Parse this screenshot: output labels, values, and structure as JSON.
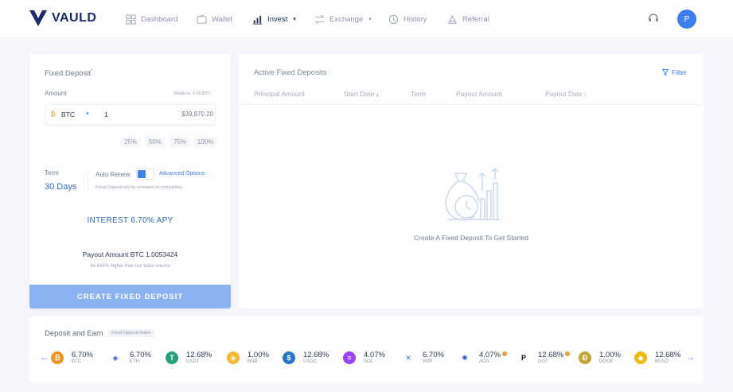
{
  "app": {
    "brand": "VAULD",
    "avatar_initial": "P"
  },
  "nav": {
    "items": [
      {
        "label": "Dashboard",
        "icon": "dashboard-icon"
      },
      {
        "label": "Wallet",
        "icon": "wallet-icon"
      },
      {
        "label": "Invest",
        "icon": "invest-icon",
        "active": true,
        "dropdown": true
      },
      {
        "label": "Exchange",
        "icon": "exchange-icon",
        "dropdown": true
      },
      {
        "label": "History",
        "icon": "history-icon"
      },
      {
        "label": "Referral",
        "icon": "referral-icon"
      }
    ]
  },
  "fixed_deposit": {
    "title": "Fixed Deposit",
    "title_marker": "*",
    "amount_label": "Amount",
    "balance_text": "Balance: 0.00 BTC",
    "currency": "BTC",
    "amount_value": "1",
    "fiat_value": "$39,970.20",
    "percent_options": [
      "25%",
      "50%",
      "75%",
      "100%"
    ],
    "term_label": "Term",
    "term_value": "30 Days",
    "auto_renew_label": "Auto Renew",
    "auto_renew_on": true,
    "advanced_options": "Advanced Options",
    "renew_note": "Fixed Deposit will be renewed on completion.",
    "interest_text": "INTEREST 6.70% APY",
    "payout_text": "Payout Amount BTC 1.0053424",
    "payout_note": "44.444% higher than our base returns",
    "create_button": "CREATE FIXED DEPOSIT"
  },
  "active_deposits": {
    "title": "Active Fixed Deposits",
    "filter_label": "Filter",
    "columns": [
      "Principal Amount",
      "Start Date",
      "Term",
      "Payout Amount",
      "Payout Date"
    ],
    "empty_text": "Create A Fixed Deposit To Get Started"
  },
  "deposit_earn": {
    "title": "Deposit and Earn",
    "tag": "Fixed Deposit Rates",
    "coins": [
      {
        "rate": "6.70%",
        "symbol": "BTC",
        "color": "#f7931a",
        "glyph": "₿"
      },
      {
        "rate": "6.70%",
        "symbol": "ETH",
        "color": "#ffffff",
        "glyph": "◆"
      },
      {
        "rate": "12.68%",
        "symbol": "USDT",
        "color": "#26a17b",
        "glyph": "T"
      },
      {
        "rate": "1.00%",
        "symbol": "BNB",
        "color": "#f3ba2f",
        "glyph": "◈"
      },
      {
        "rate": "12.68%",
        "symbol": "USDC",
        "color": "#2775ca",
        "glyph": "$"
      },
      {
        "rate": "4.07%",
        "symbol": "SOL",
        "color": "#9945ff",
        "glyph": "≡"
      },
      {
        "rate": "6.70%",
        "symbol": "XRP",
        "color": "#ffffff",
        "glyph": "✕"
      },
      {
        "rate": "4.07%",
        "symbol": "ADA",
        "color": "#ffffff",
        "glyph": "✺",
        "badge": true
      },
      {
        "rate": "12.68%",
        "symbol": "DOT",
        "color": "#ffffff",
        "glyph": "P",
        "badge": true
      },
      {
        "rate": "1.00%",
        "symbol": "DOGE",
        "color": "#c2a633",
        "glyph": "Ð"
      },
      {
        "rate": "12.68%",
        "symbol": "BUSD",
        "color": "#f0b90b",
        "glyph": "◆"
      }
    ]
  }
}
